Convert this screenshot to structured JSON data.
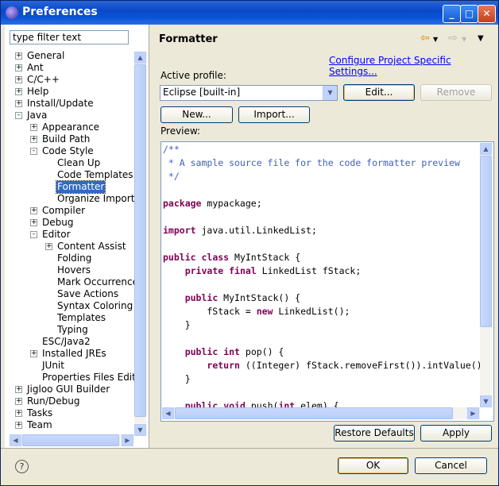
{
  "window": {
    "title": "Preferences",
    "minimize": "_",
    "maximize": "□",
    "close": "✕"
  },
  "filter": {
    "value": "type filter text"
  },
  "tree": [
    {
      "label": "General",
      "level": 0,
      "expander": "+"
    },
    {
      "label": "Ant",
      "level": 0,
      "expander": "+"
    },
    {
      "label": "C/C++",
      "level": 0,
      "expander": "+"
    },
    {
      "label": "Help",
      "level": 0,
      "expander": "+"
    },
    {
      "label": "Install/Update",
      "level": 0,
      "expander": "+"
    },
    {
      "label": "Java",
      "level": 0,
      "expander": "-"
    },
    {
      "label": "Appearance",
      "level": 1,
      "expander": "+"
    },
    {
      "label": "Build Path",
      "level": 1,
      "expander": "+"
    },
    {
      "label": "Code Style",
      "level": 1,
      "expander": "-"
    },
    {
      "label": "Clean Up",
      "level": 2,
      "expander": ""
    },
    {
      "label": "Code Templates",
      "level": 2,
      "expander": ""
    },
    {
      "label": "Formatter",
      "level": 2,
      "expander": "",
      "selected": true
    },
    {
      "label": "Organize Imports",
      "level": 2,
      "expander": ""
    },
    {
      "label": "Compiler",
      "level": 1,
      "expander": "+"
    },
    {
      "label": "Debug",
      "level": 1,
      "expander": "+"
    },
    {
      "label": "Editor",
      "level": 1,
      "expander": "-"
    },
    {
      "label": "Content Assist",
      "level": 2,
      "expander": "+"
    },
    {
      "label": "Folding",
      "level": 2,
      "expander": ""
    },
    {
      "label": "Hovers",
      "level": 2,
      "expander": ""
    },
    {
      "label": "Mark Occurrences",
      "level": 2,
      "expander": ""
    },
    {
      "label": "Save Actions",
      "level": 2,
      "expander": ""
    },
    {
      "label": "Syntax Coloring",
      "level": 2,
      "expander": ""
    },
    {
      "label": "Templates",
      "level": 2,
      "expander": ""
    },
    {
      "label": "Typing",
      "level": 2,
      "expander": ""
    },
    {
      "label": "ESC/Java2",
      "level": 1,
      "expander": ""
    },
    {
      "label": "Installed JREs",
      "level": 1,
      "expander": "+"
    },
    {
      "label": "JUnit",
      "level": 1,
      "expander": ""
    },
    {
      "label": "Properties Files Editor",
      "level": 1,
      "expander": ""
    },
    {
      "label": "Jigloo GUI Builder",
      "level": 0,
      "expander": "+"
    },
    {
      "label": "Run/Debug",
      "level": 0,
      "expander": "+"
    },
    {
      "label": "Tasks",
      "level": 0,
      "expander": "+"
    },
    {
      "label": "Team",
      "level": 0,
      "expander": "+"
    }
  ],
  "page": {
    "title": "Formatter",
    "back_icon": "⇦",
    "forward_icon": "⇨",
    "menu_icon": "▼",
    "configure_link": "Configure Project Specific Settings...",
    "active_profile_label": "Active profile:",
    "profile_value": "Eclipse [built-in]",
    "edit": "Edit...",
    "remove": "Remove",
    "new": "New...",
    "import": "Import...",
    "preview_label": "Preview:"
  },
  "code": [
    [
      [
        "cm",
        "/**"
      ]
    ],
    [
      [
        "cm",
        " * A sample source file for the code formatter preview"
      ]
    ],
    [
      [
        "cm",
        " */"
      ]
    ],
    [],
    [
      [
        "kw",
        "package"
      ],
      [
        "",
        " mypackage;"
      ]
    ],
    [],
    [
      [
        "kw",
        "import"
      ],
      [
        "",
        " java.util.LinkedList;"
      ]
    ],
    [],
    [
      [
        "kw",
        "public"
      ],
      [
        "",
        " "
      ],
      [
        "kw",
        "class"
      ],
      [
        "",
        " MyIntStack {"
      ]
    ],
    [
      [
        "",
        "    "
      ],
      [
        "kw",
        "private"
      ],
      [
        "",
        " "
      ],
      [
        "kw",
        "final"
      ],
      [
        "",
        " LinkedList fStack;"
      ]
    ],
    [],
    [
      [
        "",
        "    "
      ],
      [
        "kw",
        "public"
      ],
      [
        "",
        " MyIntStack() {"
      ]
    ],
    [
      [
        "",
        "        fStack = "
      ],
      [
        "kw",
        "new"
      ],
      [
        "",
        " LinkedList();"
      ]
    ],
    [
      [
        "",
        "    }"
      ]
    ],
    [],
    [
      [
        "",
        "    "
      ],
      [
        "kw",
        "public"
      ],
      [
        "",
        " "
      ],
      [
        "kw",
        "int"
      ],
      [
        "",
        " pop() {"
      ]
    ],
    [
      [
        "",
        "        "
      ],
      [
        "kw",
        "return"
      ],
      [
        "",
        " ((Integer) fStack.removeFirst()).intValue();"
      ]
    ],
    [
      [
        "",
        "    }"
      ]
    ],
    [],
    [
      [
        "",
        "    "
      ],
      [
        "kw",
        "public"
      ],
      [
        "",
        " "
      ],
      [
        "kw",
        "void"
      ],
      [
        "",
        " push("
      ],
      [
        "kw",
        "int"
      ],
      [
        "",
        " elem) {"
      ]
    ]
  ],
  "footer": {
    "restore_defaults": "Restore Defaults",
    "apply": "Apply",
    "ok": "OK",
    "cancel": "Cancel",
    "help_icon": "?"
  },
  "scroll": {
    "up": "▲",
    "down": "▼",
    "left": "◀",
    "right": "▶"
  }
}
